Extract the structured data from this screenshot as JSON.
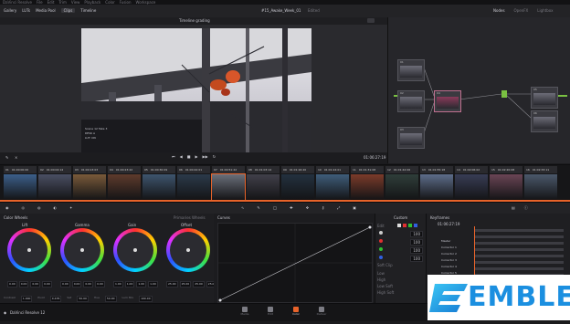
{
  "menu": [
    "DaVinci Resolve",
    "File",
    "Edit",
    "Trim",
    "View",
    "Playback",
    "Color",
    "Fusion",
    "Workspace"
  ],
  "toolbar": {
    "project_title": "#15_Awake_Week_01",
    "saved_badge": "Edited",
    "right_items": [
      "Nodes",
      "OpenFX",
      "Lightbox"
    ],
    "left_items": [
      "Gallery",
      "LUTs",
      "Media Pool",
      "Clips",
      "Timeline"
    ]
  },
  "viewer": {
    "header": "Timeline grading",
    "timecode": "01:06:27:19",
    "overlay_lines": [
      "Scene 12 Take 3",
      "DESK A",
      "LUT: ON"
    ]
  },
  "nodes": {
    "labels": [
      "01",
      "02",
      "03",
      "04",
      "05",
      "06"
    ]
  },
  "clips": [
    {
      "num": "01",
      "tc": "01:00:00:00"
    },
    {
      "num": "02",
      "tc": "01:00:04:14"
    },
    {
      "num": "03",
      "tc": "01:00:13:03"
    },
    {
      "num": "04",
      "tc": "01:00:23:22"
    },
    {
      "num": "05",
      "tc": "01:00:30:09"
    },
    {
      "num": "06",
      "tc": "01:00:42:01"
    },
    {
      "num": "07",
      "tc": "01:00:51:22"
    },
    {
      "num": "08",
      "tc": "01:01:03:14"
    },
    {
      "num": "09",
      "tc": "01:01:16:20"
    },
    {
      "num": "10",
      "tc": "01:01:24:01"
    },
    {
      "num": "11",
      "tc": "01:01:31:08"
    },
    {
      "num": "12",
      "tc": "01:01:42:06"
    },
    {
      "num": "13",
      "tc": "01:01:55:18"
    },
    {
      "num": "14",
      "tc": "01:02:06:02"
    },
    {
      "num": "15",
      "tc": "01:02:20:08"
    },
    {
      "num": "16",
      "tc": "01:02:33:11"
    }
  ],
  "clip_colors": [
    "#3c5f8a",
    "#4a4f63",
    "#7a5a3a",
    "#5e3b2c",
    "#3e556e",
    "#2b3a4a",
    "#6a6f7a",
    "#41404a",
    "#23313f",
    "#3f5d7a",
    "#7b3b2a",
    "#2f3e3a",
    "#5d6d8a",
    "#383d55",
    "#6a4555",
    "#4b586a"
  ],
  "palette": {
    "color_wheels": "Color Wheels",
    "primaries_wheels": "Primaries Wheels",
    "curves": "Curves",
    "custom": "Custom",
    "keyframes": "Keyframes",
    "wheels": [
      {
        "name": "Lift",
        "values": [
          "0.00",
          "0.00",
          "0.00",
          "0.00"
        ]
      },
      {
        "name": "Gamma",
        "values": [
          "0.00",
          "0.00",
          "0.00",
          "0.00"
        ]
      },
      {
        "name": "Gain",
        "values": [
          "1.00",
          "1.00",
          "1.00",
          "1.00"
        ]
      },
      {
        "name": "Offset",
        "values": [
          "25.00",
          "25.00",
          "25.00",
          "25.00"
        ]
      }
    ],
    "bottom_params": [
      {
        "label": "Contrast",
        "value": "1.000"
      },
      {
        "label": "Pivot",
        "value": "0.435"
      },
      {
        "label": "Sat",
        "value": "50.00"
      },
      {
        "label": "Hue",
        "value": "50.00"
      },
      {
        "label": "Lum Mix",
        "value": "100.00"
      }
    ],
    "custom_rows": [
      "Edit",
      "",
      "",
      "",
      "Soft Clip",
      "Low",
      "High",
      "Low Soft",
      "High Soft"
    ],
    "custom_values": [
      "100",
      "100",
      "100",
      "100"
    ],
    "kf_tc": "01:06:27:19",
    "kf_rows": [
      "Master",
      "Corrector 1",
      "Corrector 2",
      "Corrector 3",
      "Corrector 4",
      "Corrector 5",
      "Corrector 6",
      "Sizing"
    ]
  },
  "pages": [
    "Media",
    "Edit",
    "Color",
    "Deliver"
  ],
  "app_name": "DaVinci Resolve 12",
  "watermark": "EMBLE",
  "colors": {
    "accent": "#e8632a",
    "page_active": "#d6d6dc",
    "wheel_bg": "#2b2b30"
  }
}
